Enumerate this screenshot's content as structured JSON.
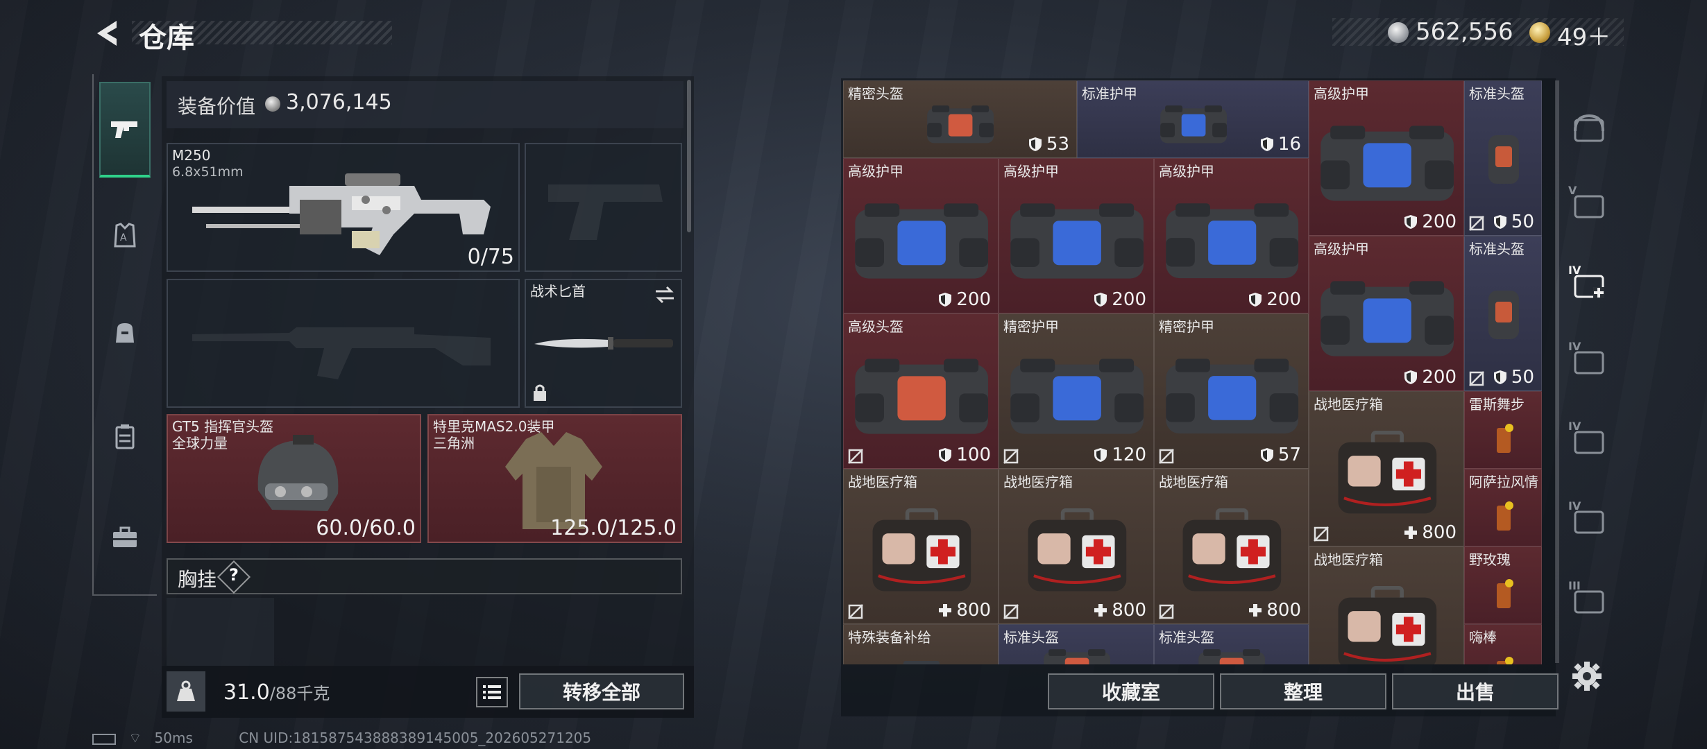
{
  "header": {
    "title": "仓库"
  },
  "currency": {
    "silver": "562,556",
    "gold": "49＋"
  },
  "equipment": {
    "label": "装备价值",
    "value": "3,076,145",
    "primary": {
      "name": "M250",
      "caliber": "6.8x51mm",
      "ammo": "0/75"
    },
    "knife": {
      "name": "战术匕首"
    },
    "helmet": {
      "name": "GT5 指挥官头盔",
      "faction": "全球力量",
      "durability": "60.0/60.0"
    },
    "armor": {
      "name": "特里克MAS2.0装甲",
      "faction": "三角洲",
      "durability": "125.0/125.0"
    },
    "chest": {
      "label": "胸挂",
      "hint": "?"
    }
  },
  "weight": {
    "current": "31.0",
    "max": "/88千克"
  },
  "buttons": {
    "transfer_all": "转移全部",
    "collection": "收藏室",
    "organize": "整理",
    "sell": "出售"
  },
  "status": {
    "ping": "50ms",
    "uid": "CN UID:18158754388838914500​5_202605271205"
  },
  "grid_items": [
    {
      "name": "精密头盔",
      "value": "53"
    },
    {
      "name": "标准护甲",
      "value": "16"
    },
    {
      "name": "高级护甲",
      "value": "200"
    },
    {
      "name": "标准头盔",
      "value": "50"
    },
    {
      "name": "高级护甲",
      "value": "200"
    },
    {
      "name": "高级护甲",
      "value": "200"
    },
    {
      "name": "高级护甲",
      "value": "200"
    },
    {
      "name": "高级护甲",
      "value": "200"
    },
    {
      "name": "标准头盔",
      "value": "50"
    },
    {
      "name": "高级头盔",
      "value": "100"
    },
    {
      "name": "精密护甲",
      "value": "120"
    },
    {
      "name": "精密护甲",
      "value": "57"
    },
    {
      "name": "战地医疗箱",
      "value": "800"
    },
    {
      "name": "雷斯舞步",
      "value": ""
    },
    {
      "name": "战地医疗箱",
      "value": "800"
    },
    {
      "name": "战地医疗箱",
      "value": "800"
    },
    {
      "name": "战地医疗箱",
      "value": "800"
    },
    {
      "name": "阿萨拉风情",
      "value": ""
    },
    {
      "name": "战地医疗箱",
      "value": ""
    },
    {
      "name": "野玫瑰",
      "value": ""
    },
    {
      "name": "特殊装备补给",
      "value": ""
    },
    {
      "name": "标准头盔",
      "value": ""
    },
    {
      "name": "标准头盔",
      "value": ""
    },
    {
      "name": "嗨棒",
      "value": ""
    }
  ],
  "right_nav": [
    "",
    "V",
    "IV",
    "IV",
    "IV",
    "IV",
    "III"
  ],
  "colors": {
    "green_accent": "#2fd28a",
    "red_slot": "#5c2a30",
    "brown_slot": "#4d4038",
    "blue_slot": "#3c3e58"
  }
}
